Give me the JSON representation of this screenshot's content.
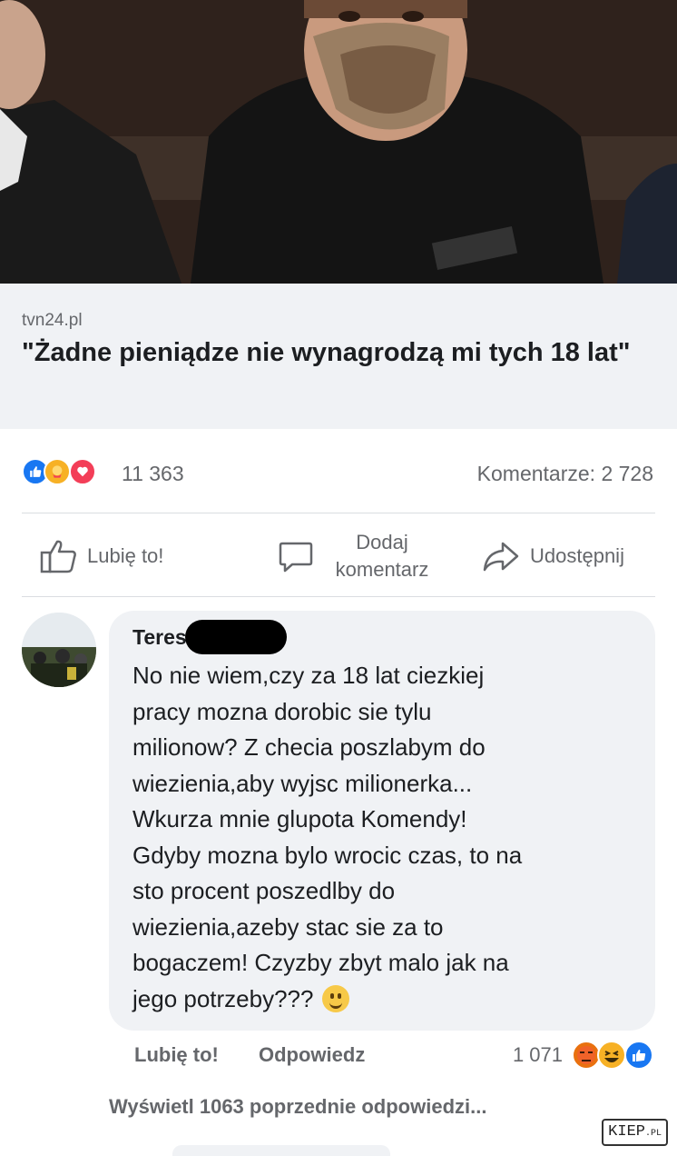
{
  "link_preview": {
    "domain": "tvn24.pl",
    "title": "\"Żadne pieniądze nie wynagrodzą mi tych 18 lat\""
  },
  "post_stats": {
    "reaction_icons": [
      "like-icon",
      "care-icon",
      "love-icon"
    ],
    "reaction_count": "11 363",
    "comment_count": "Komentarze: 2 728"
  },
  "post_actions": {
    "like_label": "Lubię to!",
    "comment_label": "Dodaj komentarz",
    "share_label": "Udostępnij"
  },
  "comment": {
    "author_visible": "Teres",
    "text": "No nie wiem,czy za 18 lat ciezkiej\npracy mozna dorobic sie  tylu\nmilionow?   Z checia poszlabym do\nwiezienia,aby wyjsc milionerka...\nWkurza mnie glupota Komendy!\nGdyby mozna bylo wrocic czas, to na\nsto procent poszedlby do\nwiezienia,azeby stac sie za to\nbogaczem!  Czyzby zbyt malo jak na\njego potrzeby???",
    "emoji": "grinning-face-icon",
    "like_label": "Lubię to!",
    "reply_label": "Odpowiedz",
    "reaction_count": "1 071",
    "reaction_icons": [
      "angry-icon",
      "haha-icon",
      "like-icon"
    ]
  },
  "view_replies": "Wyświetl 1063 poprzednie odpowiedzi...",
  "watermark": {
    "main": "KIEP",
    "suffix": ".PL"
  },
  "colors": {
    "like_blue": "#1877f2",
    "love_red": "#f33e58",
    "care_yellow": "#f7b125",
    "angry_orange": "#e9710f",
    "secondary_text": "#65676b",
    "bubble_bg": "#f0f2f5"
  }
}
